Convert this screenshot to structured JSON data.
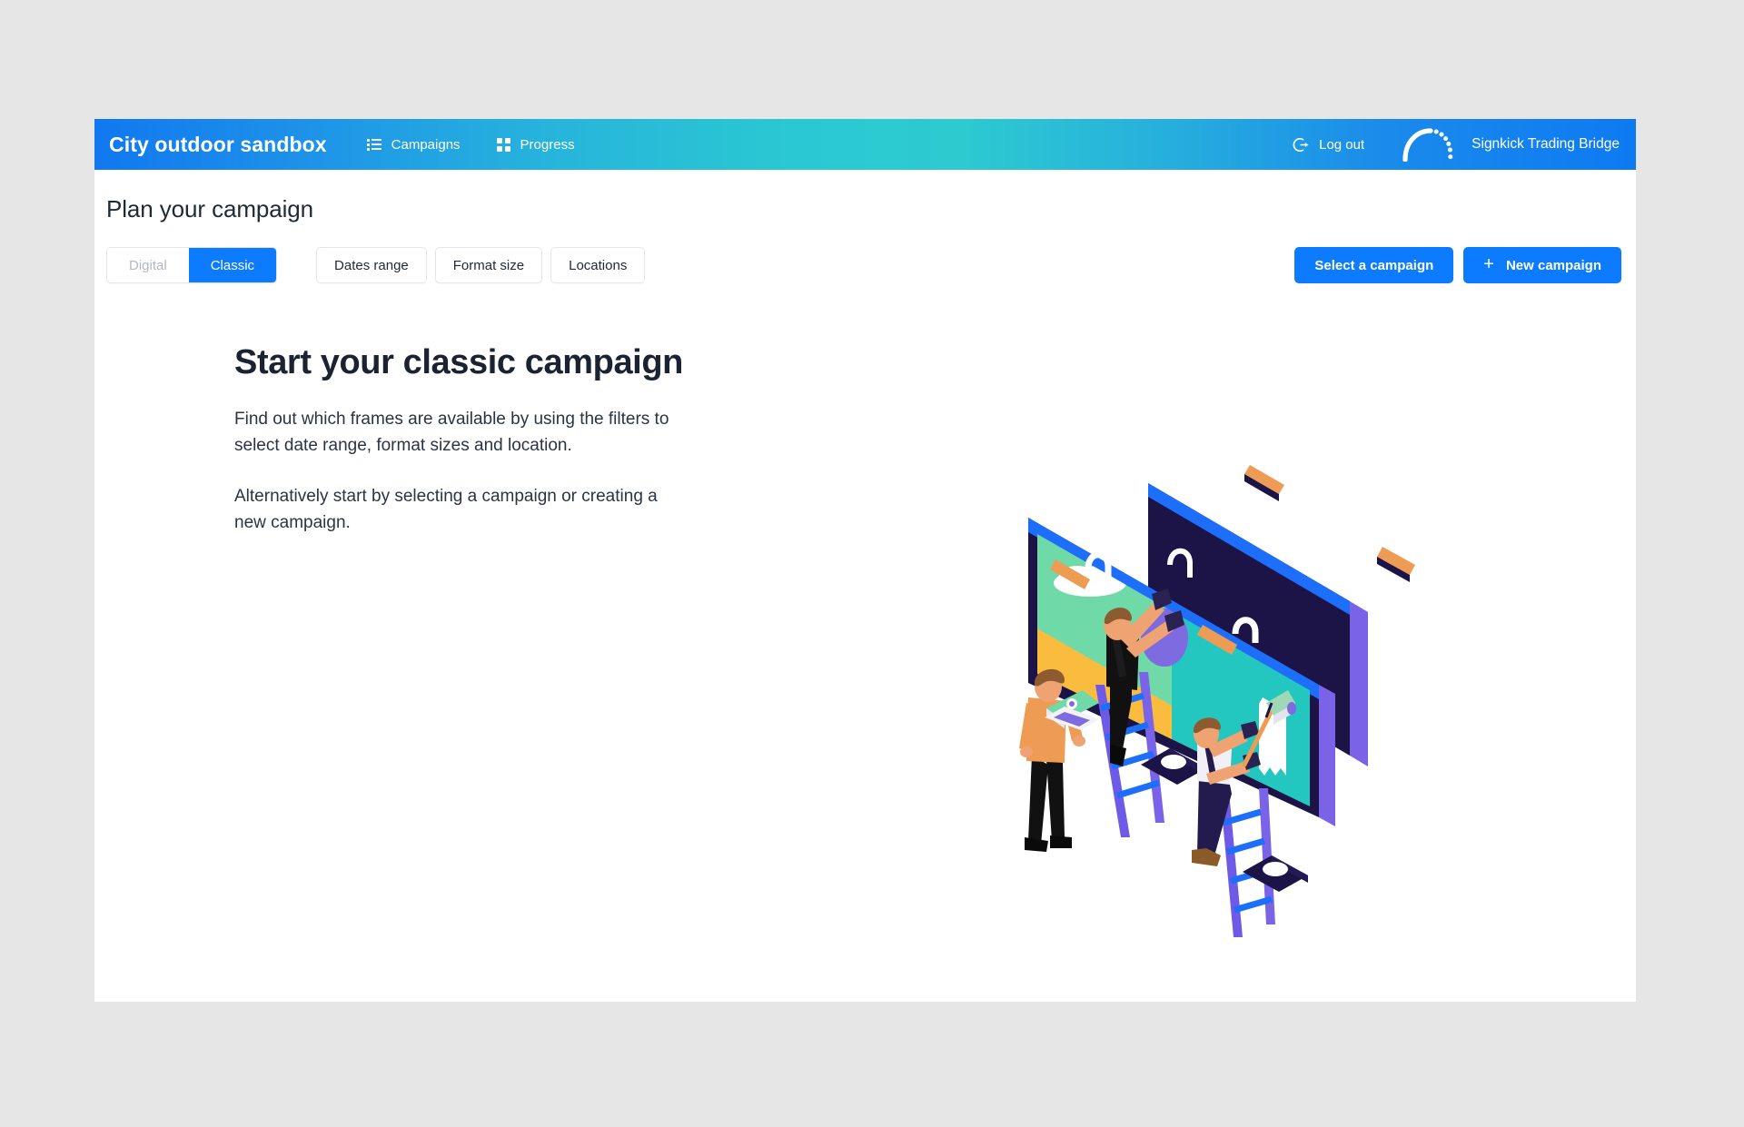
{
  "topbar": {
    "brand": "City outdoor sandbox",
    "nav": [
      {
        "label": "Campaigns",
        "icon": "list-icon"
      },
      {
        "label": "Progress",
        "icon": "grid-icon"
      }
    ],
    "logout_label": "Log out",
    "logout_icon": "logout-icon",
    "product_name": "Signkick Trading Bridge",
    "product_logo_icon": "signkick-arc-logo-icon",
    "gradient_start": "#1178f0",
    "gradient_middle": "#2dcbd0",
    "gradient_end": "#0e7af2"
  },
  "header": {
    "page_title": "Plan your campaign"
  },
  "controls": {
    "mode_toggle": {
      "options": [
        "Digital",
        "Classic"
      ],
      "selected": "Classic",
      "inactive_color": "#b3b8c0",
      "active_color": "#0d7bff"
    },
    "filters": [
      {
        "label": "Dates range"
      },
      {
        "label": "Format size"
      },
      {
        "label": "Locations"
      }
    ],
    "actions": [
      {
        "label": "Select a campaign",
        "icon": null
      },
      {
        "label": "New campaign",
        "icon": "plus-icon",
        "icon_glyph": "+"
      }
    ]
  },
  "hero": {
    "title": "Start your classic campaign",
    "paragraph_1": "Find out which frames are available by using the filters to select date range, format sizes and location.",
    "paragraph_2": "Alternatively start by selecting a campaign or creating a new campaign.",
    "illustration": {
      "name": "billboard-painters-illustration",
      "description": "Isometric billboard being painted by two workers on ladders while a third person holds a laptop",
      "colors": {
        "board_dark": "#1c1347",
        "board_blue": "#1d6efa",
        "board_purple": "#7b63e8",
        "poster_mint": "#6fd9a8",
        "poster_teal": "#24c7bf",
        "poster_yellow": "#f9bc3f",
        "poster_violet": "#7d6bdf",
        "roller_orange": "#ee9b54",
        "skin": "#f0a372",
        "hair": "#8c5b30"
      }
    }
  },
  "canvas": {
    "background": "#e6e6e6",
    "card_background": "#ffffff"
  }
}
